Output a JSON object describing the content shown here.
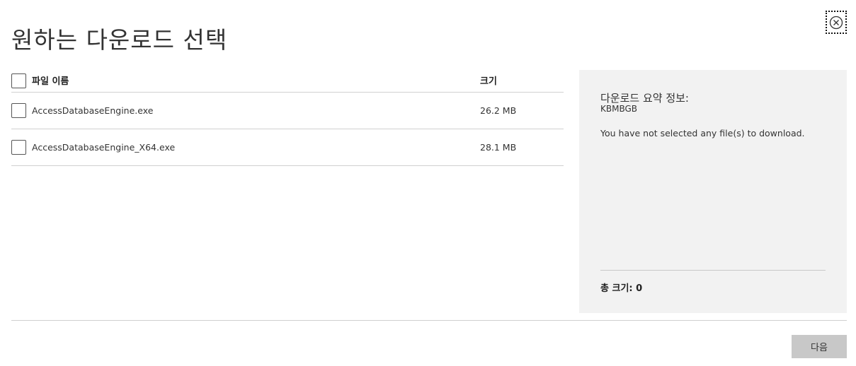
{
  "dialog": {
    "title": "원하는 다운로드 선택",
    "close_icon": "close-circle-icon"
  },
  "table": {
    "header": {
      "name": "파일 이름",
      "size": "크기"
    },
    "rows": [
      {
        "name": "AccessDatabaseEngine.exe",
        "size": "26.2 MB",
        "checked": false
      },
      {
        "name": "AccessDatabaseEngine_X64.exe",
        "size": "28.1 MB",
        "checked": false
      }
    ]
  },
  "summary": {
    "title": "다운로드 요약 정보:",
    "code": "KBMBGB",
    "message": "You have not selected any file(s) to download.",
    "total_label": "총 크기: 0"
  },
  "footer": {
    "next_label": "다음"
  }
}
